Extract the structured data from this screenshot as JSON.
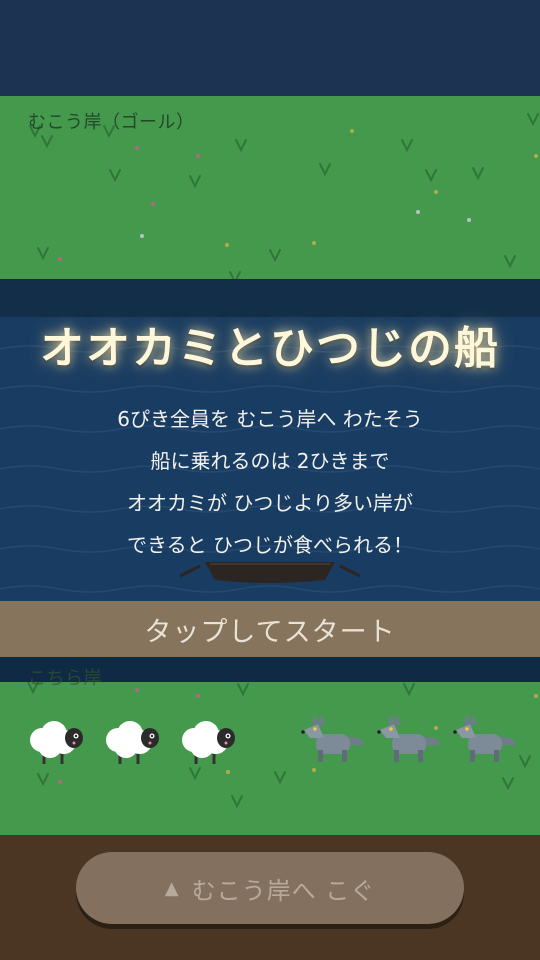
{
  "far_bank": {
    "label": "むこう岸（ゴール）"
  },
  "near_bank": {
    "label": "こちら岸"
  },
  "title": "オオカミとひつじの船",
  "rules": [
    "6ぴき全員を むこう岸へ わたそう",
    "船に乗れるのは 2ひきまで",
    "オオカミが ひつじより多い岸が",
    "できると ひつじが食べられる！"
  ],
  "start_prompt": "タップしてスタート",
  "row_button": {
    "icon": "▲",
    "label": "むこう岸へ こぐ"
  },
  "near_bank_animals": {
    "sheep": 3,
    "wolves": 3
  },
  "colors": {
    "grass": "#5ccb5b",
    "river": "#1f4a78",
    "sky": "#1c3352",
    "ground": "#4b3523",
    "button": "#84705e"
  }
}
